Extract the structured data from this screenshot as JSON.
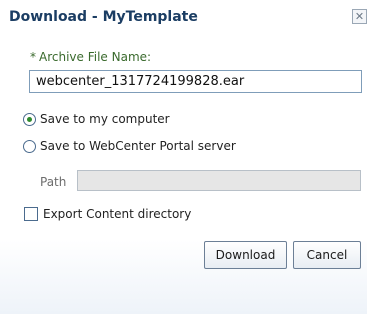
{
  "dialog": {
    "title": "Download - MyTemplate",
    "close_glyph": "✕"
  },
  "archive": {
    "label": "Archive File Name:",
    "required_marker": "*",
    "value": "webcenter_1317724199828.ear"
  },
  "options": [
    {
      "label": "Save to my computer",
      "selected": true
    },
    {
      "label": "Save to WebCenter Portal server",
      "selected": false
    }
  ],
  "path": {
    "label": "Path",
    "value": ""
  },
  "export": {
    "label": "Export Content directory",
    "checked": false
  },
  "buttons": {
    "download": "Download",
    "cancel": "Cancel"
  },
  "colors": {
    "title": "#1b3d63",
    "label": "#3a6a2d",
    "radio_selected": "#2f8a2f"
  }
}
